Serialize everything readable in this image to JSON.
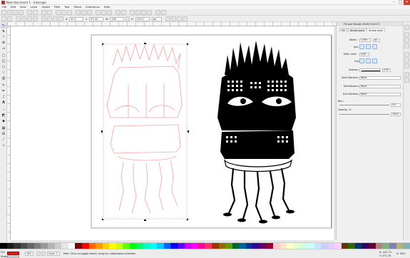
{
  "window": {
    "title": "New document 1 - Inkscape",
    "icon": "inkscape-app-icon"
  },
  "menu": [
    "File",
    "Edit",
    "View",
    "Layer",
    "Object",
    "Path",
    "Text",
    "Filters",
    "Extensions",
    "Help"
  ],
  "controls": {
    "x_label": "X",
    "x_value": "37.1",
    "y_label": "Y",
    "y_value": "37.04",
    "w_label": "W",
    "w_value": "118",
    "h_label": "H",
    "h_value": "215.1",
    "units": "px"
  },
  "dock": {
    "title": "Fill and Stroke (Shift+Ctrl+F)",
    "tabs": [
      "Fill",
      "Stroke paint",
      "Stroke style"
    ],
    "width_label": "Width:",
    "width_value": "1.000",
    "width_unit": "px",
    "join_label": "Join:",
    "miter_label": "Miter limit:",
    "miter_value": "4.00",
    "cap_label": "Cap:",
    "dashes_label": "Dashes:",
    "dashes_value": "0.00",
    "start_markers_label": "Start Markers:",
    "start_markers_value": "None",
    "mid_markers_label": "Mid Markers:",
    "mid_markers_value": "None",
    "end_markers_label": "End Markers:",
    "end_markers_value": "None",
    "blur_label": "Blur:",
    "blur_value": "0.0",
    "opacity_label": "Opacity, %",
    "opacity_value": "100.0"
  },
  "status": {
    "fill_label": "Fill:",
    "stroke_label": "Stroke:",
    "opacity_value": "100",
    "layer_value": "Layer 1",
    "message": "Path: Click to toggle select; drag for rubberband selection",
    "coords_x": "X: 447.72",
    "coords_y": "Y: 471.33",
    "zoom": "Z: 50%"
  },
  "colors": {
    "accent": "#c84032",
    "fill_swatch": "#d42020"
  },
  "palette": [
    "#000000",
    "#1a1a1a",
    "#333333",
    "#4d4d4d",
    "#666666",
    "#808080",
    "#999999",
    "#b3b3b3",
    "#cccccc",
    "#e6e6e6",
    "#ffffff",
    "#800000",
    "#ff0000",
    "#ff6600",
    "#ff9900",
    "#ffcc00",
    "#ffff00",
    "#ccff00",
    "#66ff00",
    "#00ff00",
    "#00ff66",
    "#00ffcc",
    "#00ffff",
    "#00ccff",
    "#0066ff",
    "#0000ff",
    "#6600ff",
    "#cc00ff",
    "#ff00ff",
    "#ff0099",
    "#ff3366",
    "#993300",
    "#996600",
    "#669900",
    "#006633",
    "#006699",
    "#003399",
    "#330099",
    "#660066",
    "#990033",
    "#ffcccc",
    "#ffe5cc",
    "#ffffcc",
    "#e5ffcc",
    "#ccffe5",
    "#ccffff",
    "#cce5ff",
    "#ccccff",
    "#e5ccff",
    "#ffccff",
    "#663300",
    "#336600",
    "#003366",
    "#330066",
    "#660033",
    "#b38080",
    "#80b380",
    "#8080b3",
    "#b3b380",
    "#80b3b3"
  ]
}
